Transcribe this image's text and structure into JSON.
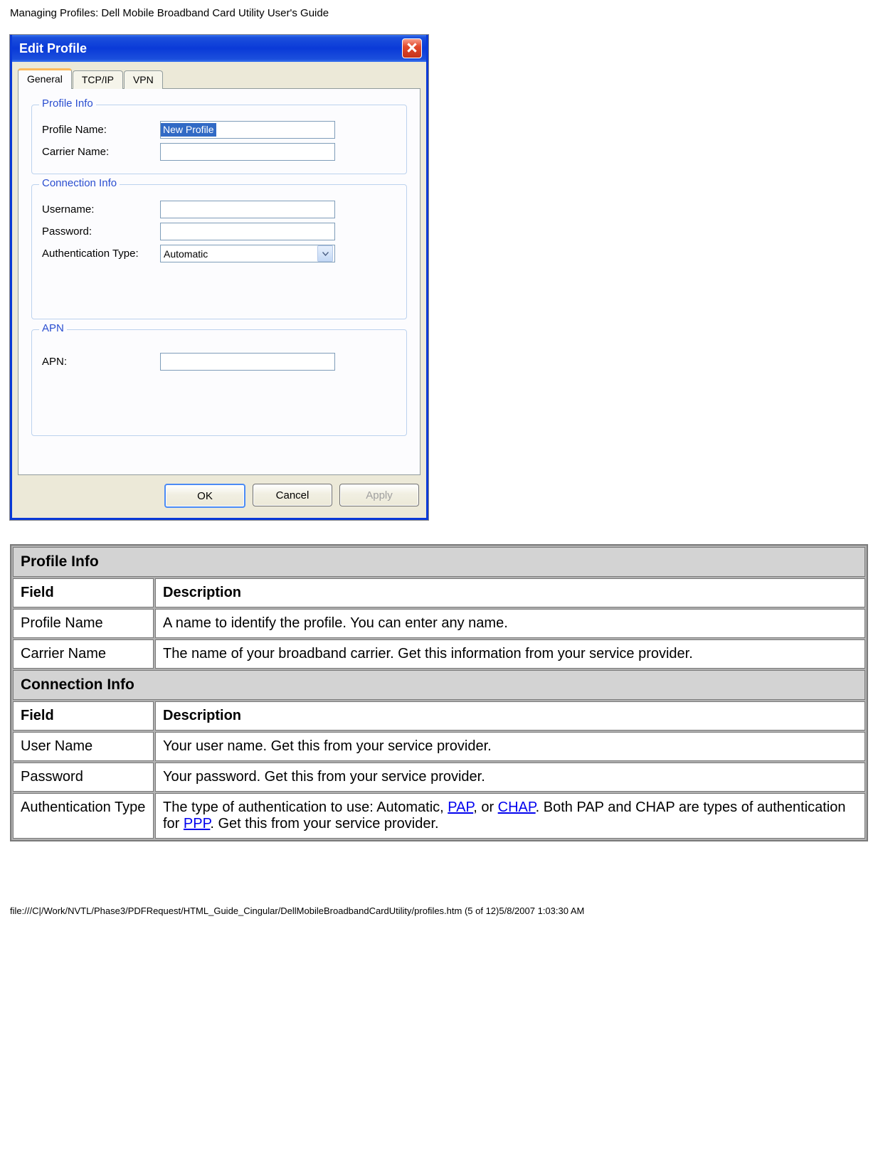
{
  "page_header": "Managing Profiles: Dell Mobile Broadband Card Utility User's Guide",
  "footer_path": "file:///C|/Work/NVTL/Phase3/PDFRequest/HTML_Guide_Cingular/DellMobileBroadbandCardUtility/profiles.htm (5 of 12)5/8/2007 1:03:30 AM",
  "dialog": {
    "title": "Edit Profile",
    "tabs": {
      "general": "General",
      "tcpip": "TCP/IP",
      "vpn": "VPN"
    },
    "groups": {
      "profile_info": {
        "title": "Profile Info",
        "profile_name_label": "Profile Name:",
        "profile_name_value": "New Profile",
        "carrier_name_label": "Carrier Name:",
        "carrier_name_value": ""
      },
      "connection_info": {
        "title": "Connection Info",
        "username_label": "Username:",
        "username_value": "",
        "password_label": "Password:",
        "password_value": "",
        "auth_type_label": "Authentication Type:",
        "auth_type_value": "Automatic"
      },
      "apn": {
        "title": "APN",
        "apn_label": "APN:",
        "apn_value": ""
      }
    },
    "buttons": {
      "ok": "OK",
      "cancel": "Cancel",
      "apply": "Apply"
    }
  },
  "table": {
    "section1": {
      "title": "Profile Info",
      "field_h": "Field",
      "desc_h": "Description"
    },
    "rows1": [
      {
        "field": "Profile Name",
        "desc": "A name to identify the profile. You can enter any name."
      },
      {
        "field": "Carrier Name",
        "desc": "The name of your broadband carrier. Get this information from your service provider."
      }
    ],
    "section2": {
      "title": "Connection Info",
      "field_h": "Field",
      "desc_h": "Description"
    },
    "rows2": [
      {
        "field": "User Name",
        "desc": "Your user name. Get this from your service provider."
      },
      {
        "field": "Password",
        "desc": "Your password. Get this from your service provider."
      }
    ],
    "auth_row": {
      "field": "Authentication Type",
      "t1": "The type of authentication to use: Automatic, ",
      "link_pap": "PAP",
      "t2": ", or ",
      "link_chap": "CHAP",
      "t3": ". Both PAP and CHAP are types of authentication for ",
      "link_ppp": "PPP",
      "t4": ". Get this from your service provider."
    }
  }
}
